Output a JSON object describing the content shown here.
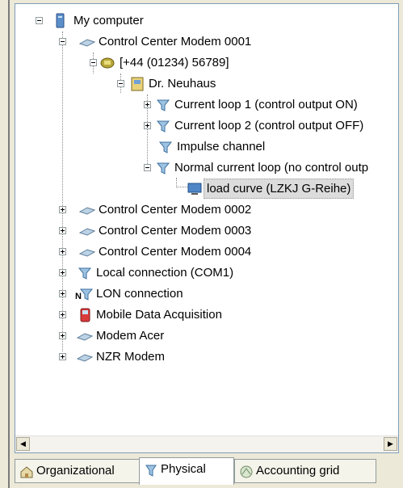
{
  "tree": {
    "items": [
      {
        "label": "My computer",
        "icon": "computer-icon",
        "expander": "minus"
      },
      {
        "label": "Control Center Modem 0001",
        "icon": "modem-icon",
        "expander": "minus"
      },
      {
        "label": "[+44 (01234) 56789]",
        "icon": "phone-connection-icon",
        "expander": "minus"
      },
      {
        "label": "Dr. Neuhaus",
        "icon": "device-icon",
        "expander": "minus"
      },
      {
        "label": "Current loop 1 (control output ON)",
        "icon": "channel-icon",
        "expander": "plus"
      },
      {
        "label": "Current loop 2 (control output OFF)",
        "icon": "channel-icon",
        "expander": "plus"
      },
      {
        "label": "Impulse channel",
        "icon": "channel-icon",
        "expander": ""
      },
      {
        "label": "Normal current loop (no control outp",
        "icon": "channel-icon",
        "expander": "minus"
      },
      {
        "label": "load curve (LZKJ G-Reihe)",
        "icon": "monitor-icon",
        "expander": ""
      },
      {
        "label": "Control Center Modem 0002",
        "icon": "modem-icon",
        "expander": "plus"
      },
      {
        "label": "Control Center Modem 0003",
        "icon": "modem-icon",
        "expander": "plus"
      },
      {
        "label": "Control Center Modem 0004",
        "icon": "modem-icon",
        "expander": "plus"
      },
      {
        "label": "Local connection (COM1)",
        "icon": "local-connection-icon",
        "expander": "plus"
      },
      {
        "label": "LON connection",
        "icon": "lon-connection-icon",
        "expander": "plus"
      },
      {
        "label": "Mobile Data Acquisition",
        "icon": "mobile-acquisition-icon",
        "expander": "plus"
      },
      {
        "label": "Modem Acer",
        "icon": "modem-icon",
        "expander": "plus"
      },
      {
        "label": "NZR Modem",
        "icon": "modem-icon",
        "expander": "plus"
      }
    ],
    "selected_label": "load curve (LZKJ G-Reihe)"
  },
  "tabs": [
    {
      "label": "Organizational",
      "icon": "house-icon"
    },
    {
      "label": "Physical",
      "icon": "connection-icon",
      "active": true
    },
    {
      "label": "Accounting grid",
      "icon": "grid-icon"
    }
  ]
}
